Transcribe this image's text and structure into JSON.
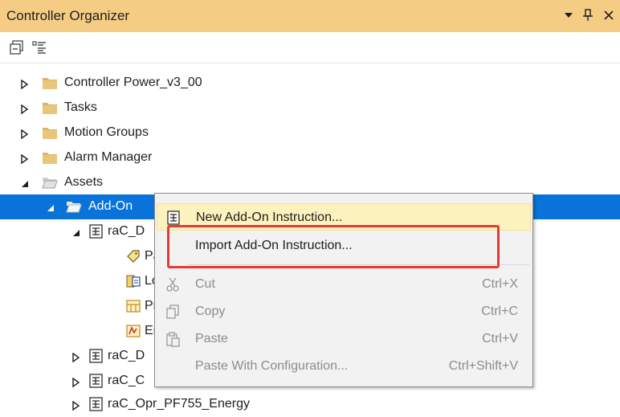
{
  "panel": {
    "title": "Controller Organizer",
    "dropdown_icon": "chevron-down-icon",
    "pin_icon": "pin-icon",
    "close_icon": "close-icon"
  },
  "toolbar": {
    "icons": [
      "collapse-all-icon",
      "list-view-icon"
    ]
  },
  "tree": {
    "items": [
      {
        "label": "Controller Power_v3_00",
        "expanded": false,
        "icon": "folder-icon"
      },
      {
        "label": "Tasks",
        "expanded": false,
        "icon": "folder-icon"
      },
      {
        "label": "Motion Groups",
        "expanded": false,
        "icon": "folder-icon"
      },
      {
        "label": "Alarm Manager",
        "expanded": false,
        "icon": "folder-icon"
      },
      {
        "label": "Assets",
        "expanded": true,
        "icon": "open-folder-icon"
      },
      {
        "label": "Add-On",
        "expanded": true,
        "icon": "open-folder-icon",
        "selected": true
      },
      {
        "label": "raC_D",
        "expanded": true,
        "icon": "add-on-instruction-icon"
      },
      {
        "label": "Pa",
        "icon": "parameters-tag-icon"
      },
      {
        "label": "Lo",
        "icon": "local-tags-icon"
      },
      {
        "label": "Pr",
        "icon": "prescan-routine-icon"
      },
      {
        "label": "Er",
        "icon": "enable-false-routine-icon"
      },
      {
        "label": "raC_D",
        "expanded": false,
        "icon": "add-on-instruction-icon"
      },
      {
        "label": "raC_C",
        "expanded": false,
        "icon": "add-on-instruction-icon"
      },
      {
        "label": "raC_Opr_PF755_Energy",
        "expanded": false,
        "icon": "add-on-instruction-icon"
      }
    ]
  },
  "context_menu": {
    "items": [
      {
        "label": "New Add-On Instruction...",
        "shortcut": "",
        "enabled": true,
        "hot": true,
        "icon": "new-instruction-icon"
      },
      {
        "label": "Import Add-On Instruction...",
        "shortcut": "",
        "enabled": true,
        "hot": false,
        "icon": ""
      },
      {
        "label": "Cut",
        "shortcut": "Ctrl+X",
        "enabled": false,
        "icon": "cut-icon"
      },
      {
        "label": "Copy",
        "shortcut": "Ctrl+C",
        "enabled": false,
        "icon": "copy-icon"
      },
      {
        "label": "Paste",
        "shortcut": "Ctrl+V",
        "enabled": false,
        "icon": "paste-icon"
      },
      {
        "label": "Paste With Configuration...",
        "shortcut": "Ctrl+Shift+V",
        "enabled": false,
        "icon": ""
      }
    ]
  },
  "colors": {
    "title_bar": "#f5cc84",
    "selection": "#0a73d9",
    "hot_item": "#fcf2be",
    "annotation": "#e53b36"
  }
}
